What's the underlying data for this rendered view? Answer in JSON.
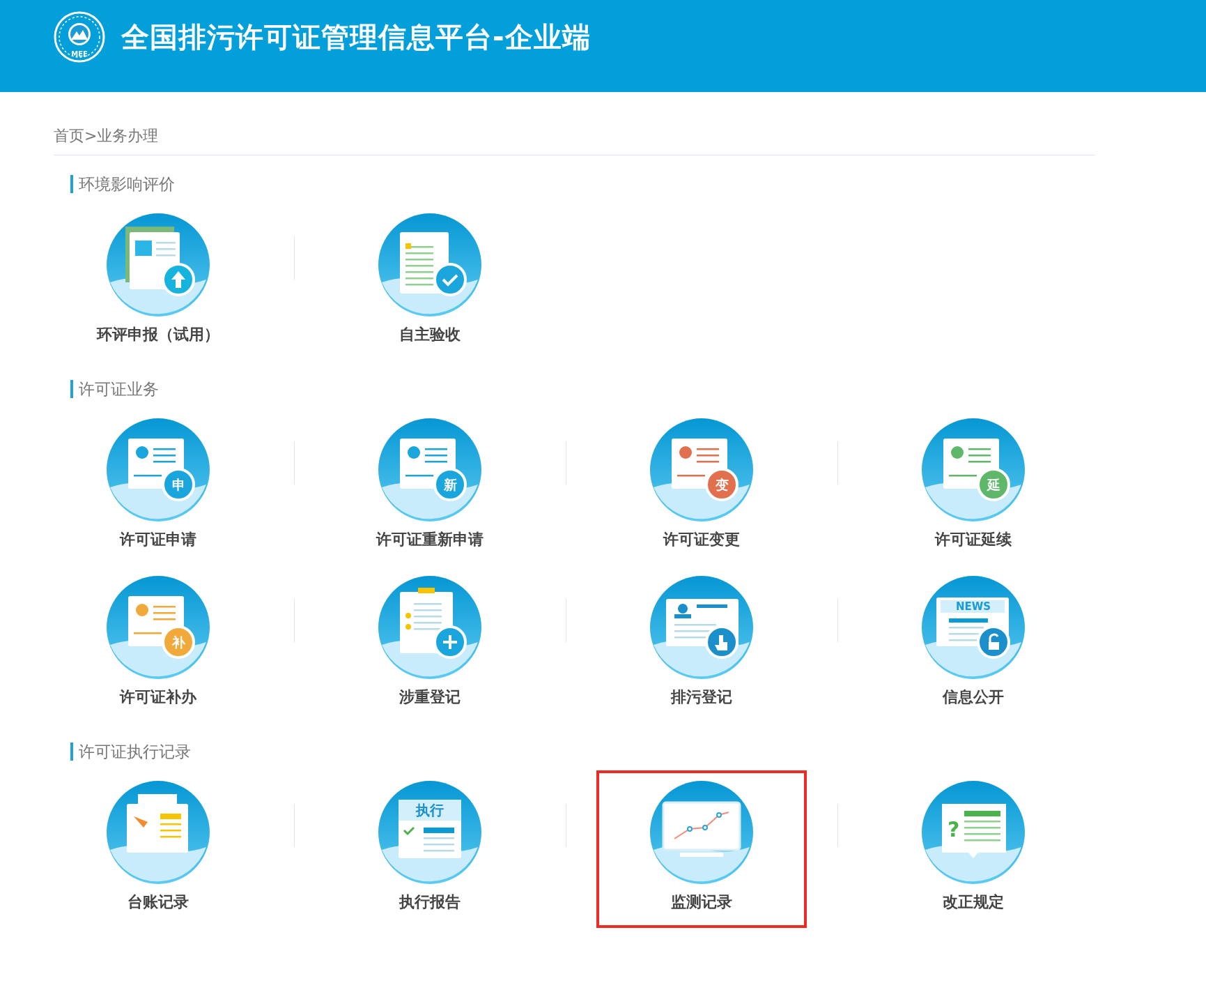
{
  "header": {
    "title": "全国排污许可证管理信息平台-企业端",
    "logo_text": "MEE"
  },
  "breadcrumb": "首页>业务办理",
  "sections": [
    {
      "title": "环境影响评价",
      "items": [
        {
          "label": "环评申报（试用）",
          "kind": "upload",
          "highlighted": false
        },
        {
          "label": "自主验收",
          "kind": "check",
          "highlighted": false
        }
      ]
    },
    {
      "title": "许可证业务",
      "items": [
        {
          "label": "许可证申请",
          "kind": "license",
          "badge": "申",
          "color": "#1aa6dc",
          "highlighted": false
        },
        {
          "label": "许可证重新申请",
          "kind": "license",
          "badge": "新",
          "color": "#1aa6dc",
          "highlighted": false
        },
        {
          "label": "许可证变更",
          "kind": "license",
          "badge": "变",
          "color": "#e2704e",
          "highlighted": false
        },
        {
          "label": "许可证延续",
          "kind": "license",
          "badge": "延",
          "color": "#5fb86a",
          "highlighted": false
        },
        {
          "label": "许可证补办",
          "kind": "license",
          "badge": "补",
          "color": "#f2a93b",
          "highlighted": false
        },
        {
          "label": "涉重登记",
          "kind": "add",
          "highlighted": false
        },
        {
          "label": "排污登记",
          "kind": "hand",
          "highlighted": false
        },
        {
          "label": "信息公开",
          "kind": "news",
          "doc_text": "NEWS",
          "highlighted": false
        }
      ]
    },
    {
      "title": "许可证执行记录",
      "items": [
        {
          "label": "台账记录",
          "kind": "ledger",
          "highlighted": false
        },
        {
          "label": "执行报告",
          "kind": "report",
          "doc_text": "执行",
          "highlighted": false
        },
        {
          "label": "监测记录",
          "kind": "chart",
          "highlighted": true
        },
        {
          "label": "改正规定",
          "kind": "question",
          "doc_text": "?",
          "highlighted": false
        }
      ]
    }
  ]
}
